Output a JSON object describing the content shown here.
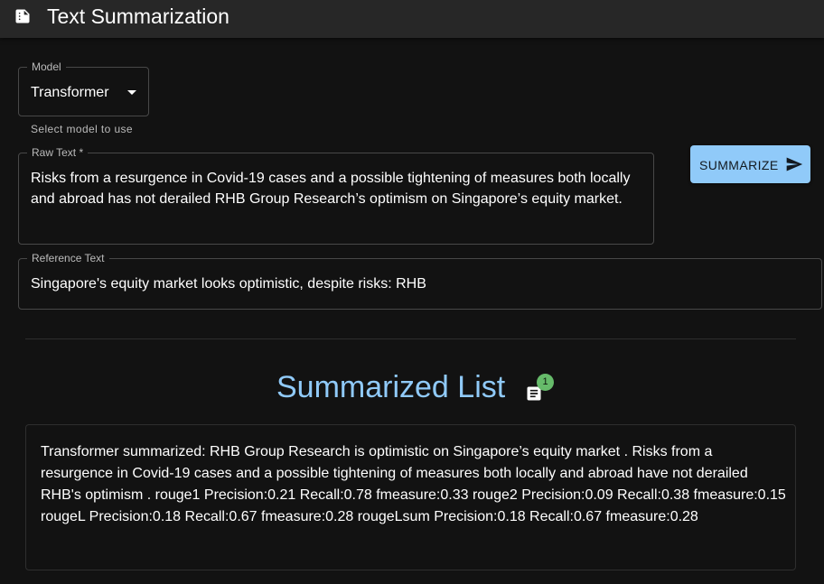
{
  "app": {
    "title": "Text Summarization",
    "icon": "summarize-document-icon"
  },
  "model": {
    "label": "Model",
    "value": "Transformer",
    "helper": "Select model to use"
  },
  "raw_text": {
    "label": "Raw Text *",
    "value": "Risks from a resurgence in Covid-19 cases and a possible tightening of measures both locally and abroad has not derailed RHB Group Research’s optimism on Singapore’s equity market."
  },
  "reference_text": {
    "label": "Reference Text",
    "value": "Singapore's equity market looks optimistic, despite risks: RHB"
  },
  "summarize_button": {
    "label": "SUMMARIZE",
    "icon": "send-icon"
  },
  "summary_list": {
    "title": "Summarized List",
    "badge_count": "1",
    "items": [
      "Transformer summarized: RHB Group Research is optimistic on Singapore’s equity market . Risks from a resurgence in Covid-19 cases and a possible tightening of measures both locally and abroad have not derailed RHB's optimism . rouge1 Precision:0.21 Recall:0.78 fmeasure:0.33 rouge2 Precision:0.09 Recall:0.38 fmeasure:0.15 rougeL Precision:0.18 Recall:0.67 fmeasure:0.28 rougeLsum Precision:0.18 Recall:0.67 fmeasure:0.28"
    ]
  },
  "colors": {
    "background": "#121212",
    "appbar": "#272727",
    "primary": "#90caf9",
    "badge": "#66bb6a"
  }
}
